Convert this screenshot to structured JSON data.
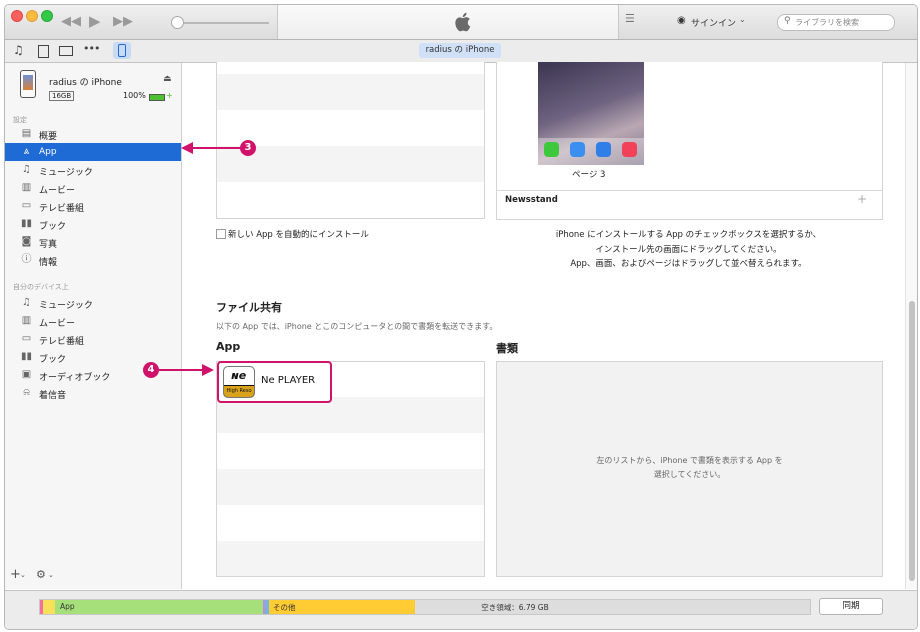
{
  "colors": {
    "accent": "#1f6bd6",
    "callout": "#d0126b",
    "storage_app": "#a6e07a",
    "storage_other": "#ffcc33",
    "storage_free": "#dddddd"
  },
  "titlebar": {
    "signin_label": "サインイン",
    "search_placeholder": "ライブラリを検索"
  },
  "toolbar": {
    "device_tab": "radius の iPhone"
  },
  "device": {
    "name": "radius の iPhone",
    "capacity": "16GB",
    "battery": "100%"
  },
  "sidebar": {
    "settings_header": "設定",
    "settings_items": [
      {
        "label": "概要",
        "icon": "summary-icon"
      },
      {
        "label": "App",
        "icon": "app-store-icon"
      },
      {
        "label": "ミュージック",
        "icon": "music-note-icon"
      },
      {
        "label": "ムービー",
        "icon": "film-icon"
      },
      {
        "label": "テレビ番組",
        "icon": "tv-icon"
      },
      {
        "label": "ブック",
        "icon": "book-icon"
      },
      {
        "label": "写真",
        "icon": "camera-icon"
      },
      {
        "label": "情報",
        "icon": "info-icon"
      }
    ],
    "ondevice_header": "自分のデバイス上",
    "ondevice_items": [
      {
        "label": "ミュージック",
        "icon": "music-note-icon"
      },
      {
        "label": "ムービー",
        "icon": "film-icon"
      },
      {
        "label": "テレビ番組",
        "icon": "tv-icon"
      },
      {
        "label": "ブック",
        "icon": "book-icon"
      },
      {
        "label": "オーディオブック",
        "icon": "audiobook-icon"
      },
      {
        "label": "着信音",
        "icon": "bell-icon"
      }
    ]
  },
  "apps": {
    "auto_install_label": "新しい App を自動的にインストール",
    "page_label": "ページ 3",
    "newsstand_label": "Newsstand",
    "instructions": [
      "iPhone にインストールする App のチェックボックスを選択するか、",
      "インストール先の画面にドラッグしてください。",
      "App、画面、およびページはドラッグして並べ替えられます。"
    ]
  },
  "file_sharing": {
    "title": "ファイル共有",
    "description": "以下の App では、iPhone とこのコンピュータとの間で書類を転送できます。",
    "apps_header": "App",
    "docs_header": "書類",
    "app_name": "Ne PLAYER",
    "app_icon_caption": "High Reso",
    "docs_empty": [
      "左のリストから、iPhone で書類を表示する App を",
      "選択してください。"
    ]
  },
  "callouts": {
    "app_nav": "3",
    "ne_player": "4"
  },
  "storage": {
    "app_label": "App",
    "other_label": "その他",
    "free_label": "空き領域：6.79 GB",
    "app_fraction": 0.27,
    "other_fraction": 0.19
  },
  "sync_button": "同期"
}
